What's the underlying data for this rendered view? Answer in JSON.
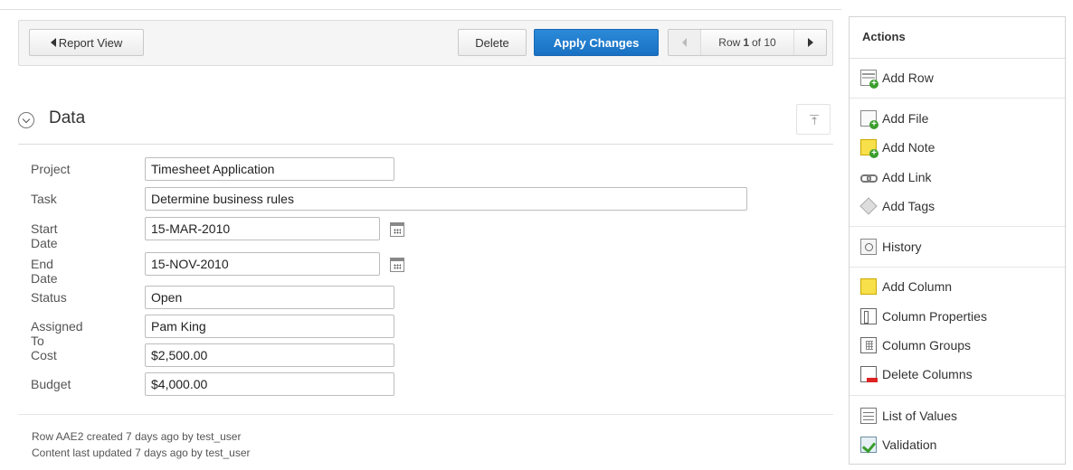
{
  "toolbar": {
    "report_view": "Report View",
    "delete": "Delete",
    "apply": "Apply Changes",
    "pager": {
      "row_prefix": "Row",
      "row_current": "1",
      "row_suffix": "of 10"
    }
  },
  "region": {
    "title": "Data"
  },
  "form": {
    "fields": [
      {
        "label": "Project",
        "value": "Timesheet Application"
      },
      {
        "label": "Task",
        "value": "Determine business rules"
      },
      {
        "label": "Start Date",
        "value": "15-MAR-2010"
      },
      {
        "label": "End Date",
        "value": "15-NOV-2010"
      },
      {
        "label": "Status",
        "value": "Open"
      },
      {
        "label": "Assigned To",
        "value": "Pam King"
      },
      {
        "label": "Cost",
        "value": "$2,500.00"
      },
      {
        "label": "Budget",
        "value": "$4,000.00"
      }
    ]
  },
  "meta": {
    "created": "Row AAE2 created 7 days ago by test_user",
    "updated": "Content last updated 7 days ago by test_user"
  },
  "sidebar": {
    "title": "Actions",
    "items": [
      {
        "label": "Add Row",
        "icon": "add-row-icon"
      },
      {
        "label": "Add File",
        "icon": "add-file-icon"
      },
      {
        "label": "Add Note",
        "icon": "add-note-icon"
      },
      {
        "label": "Add Link",
        "icon": "add-link-icon"
      },
      {
        "label": "Add Tags",
        "icon": "add-tags-icon"
      },
      {
        "label": "History",
        "icon": "history-icon"
      },
      {
        "label": "Add Column",
        "icon": "add-column-icon"
      },
      {
        "label": "Column Properties",
        "icon": "column-properties-icon"
      },
      {
        "label": "Column Groups",
        "icon": "column-groups-icon"
      },
      {
        "label": "Delete Columns",
        "icon": "delete-columns-icon"
      },
      {
        "label": "List of Values",
        "icon": "list-of-values-icon"
      },
      {
        "label": "Validation",
        "icon": "validation-icon"
      }
    ]
  },
  "colors": {
    "primary": "#1a71c3",
    "panel_bg": "#f5f5f5",
    "border": "#dcdcdc"
  }
}
